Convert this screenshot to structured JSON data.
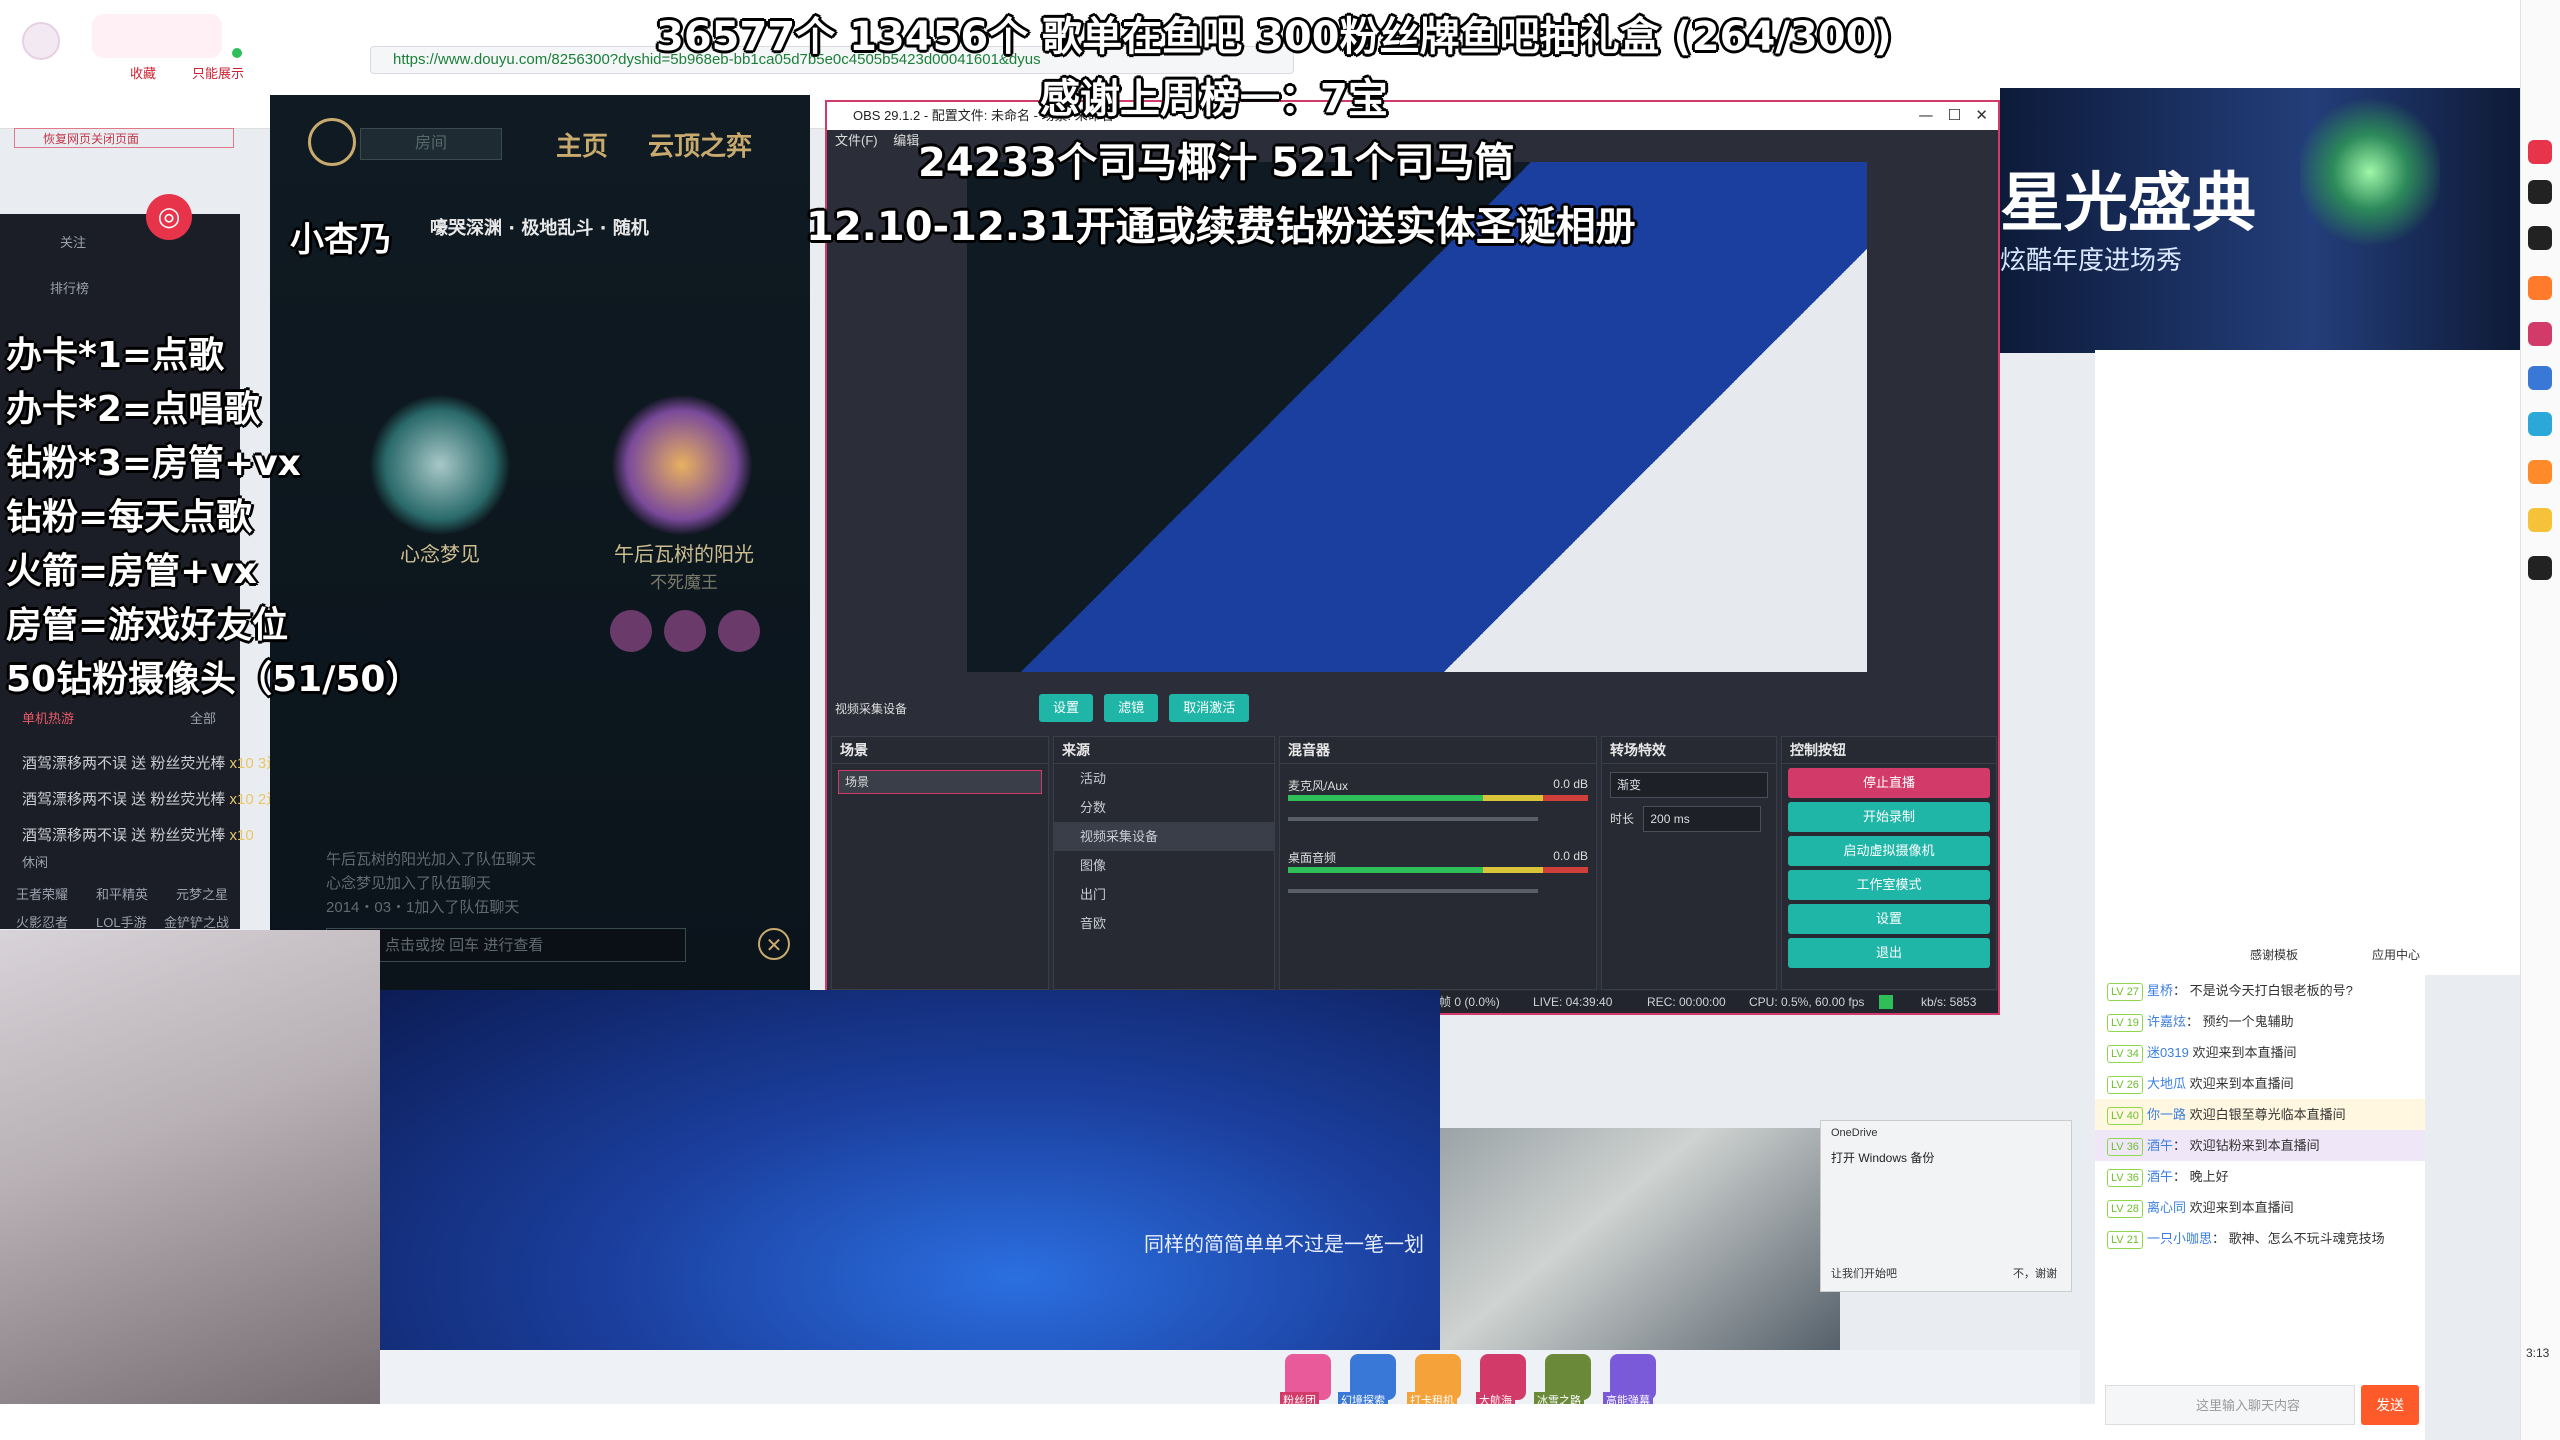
{
  "browser": {
    "url": "https://www.douyu.com/8256300?dyshid=5b968eb-bb1ca05d7b5e0c4505b5423d00041601&dyus",
    "tab_left": "收藏",
    "tab_next": "只能展示",
    "notice": "恢复网页关闭页面"
  },
  "overlay": {
    "line1": "36577个 13456个  歌单在鱼吧 300粉丝牌鱼吧抽礼盒 (264/300)",
    "line2": "感谢上周榜一：7宝",
    "line3": "24233个司马椰汁  521个司马筒",
    "line4": "12.10-12.31开通或续费钻粉送实体圣诞相册"
  },
  "rules": [
    "办卡*1=点歌",
    "办卡*2=点唱歌",
    "钻粉*3=房管+vx",
    "钻粉=每天点歌",
    "火箭=房管+vx",
    "房管=游戏好友位",
    "50钻粉摄像头（51/50）"
  ],
  "left_panel": {
    "follow": "关注",
    "rank": "排行榜",
    "hot": "单机热游",
    "more": "全部",
    "leisure": "休闲",
    "games": [
      "王者荣耀",
      "和平精英",
      "元梦之星",
      "火影忍者",
      "LOL手游",
      "金铲铲之战"
    ],
    "gift_msgs": [
      {
        "text": "酒驾漂移两不误 送 粉丝荧光棒",
        "count": "x10 3连击"
      },
      {
        "text": "酒驾漂移两不误 送 粉丝荧光棒",
        "count": "x10 2连击"
      },
      {
        "text": "酒驾漂移两不误 送 粉丝荧光棒",
        "count": "x10"
      }
    ]
  },
  "lol": {
    "search": "房间",
    "nav_home": "主页",
    "nav_tft": "云顶之弈",
    "user": "小杏乃",
    "mode": "嚎哭深渊 · 极地乱斗 · 随机",
    "player1": "心念梦见",
    "player2": "午后瓦树的阳光",
    "player2_rank": "不死魔王",
    "chat": [
      "午后瓦树的阳光加入了队伍聊天",
      "心念梦见加入了队伍聊天",
      "2014・03・1加入了队伍聊天"
    ],
    "chat_hint": "点击或按 回车 进行查看"
  },
  "obs": {
    "title": "OBS 29.1.2 - 配置文件: 未命名 - 场景: 未命名",
    "menu": [
      "文件(F)",
      "编辑"
    ],
    "source_label": "视频采集设备",
    "tb_settings": "设置",
    "tb_filters": "滤镜",
    "tb_deactivate": "取消激活",
    "scenes_title": "场景",
    "scene_item": "场景",
    "sources_title": "来源",
    "sources": [
      "活动",
      "分数",
      "视频采集设备",
      "图像",
      "出门",
      "音欧"
    ],
    "mixer_title": "混音器",
    "mic_label": "麦克风/Aux",
    "mic_db": "0.0 dB",
    "desk_label": "桌面音频",
    "desk_db": "0.0 dB",
    "trans_title": "转场特效",
    "trans_value": "渐变",
    "duration_label": "时长",
    "duration_value": "200 ms",
    "controls_title": "控制按钮",
    "controls": [
      "停止直播",
      "开始录制",
      "启动虚拟摄像机",
      "工作室模式",
      "设置",
      "退出"
    ],
    "status": {
      "dropped": "丢帧 0 (0.0%)",
      "live": "LIVE: 04:39:40",
      "rec": "REC: 00:00:00",
      "cpu": "CPU: 0.5%, 60.00 fps",
      "kbs": "kb/s: 5853"
    }
  },
  "banner": {
    "title": "星光盛典",
    "subtitle": "炫酷年度进场秀"
  },
  "chat": {
    "messages": [
      {
        "lv": "LV 27",
        "nick": "星桥",
        "text": "不是说今天打白银老板的号?"
      },
      {
        "lv": "LV 19",
        "nick": "许嘉炫",
        "text": "预约一个鬼辅助"
      },
      {
        "lv": "LV 34",
        "nick": "迷0319",
        "text": "欢迎来到本直播间"
      },
      {
        "lv": "LV 26",
        "nick": "大地瓜",
        "text": "欢迎来到本直播间"
      },
      {
        "lv": "LV 40",
        "nick": "你一路",
        "text": "欢迎白银至尊光临本直播间"
      },
      {
        "lv": "LV 36",
        "nick": "酒午",
        "text": "欢迎钻粉来到本直播间"
      },
      {
        "lv": "LV 36",
        "nick": "酒午",
        "text": "晚上好"
      },
      {
        "lv": "LV 28",
        "nick": "离心同",
        "text": "欢迎来到本直播间"
      },
      {
        "lv": "LV 21",
        "nick": "一只小咖思",
        "text": "歌神、怎么不玩斗魂竞技场"
      }
    ],
    "input_placeholder": "这里输入聊天内容",
    "send": "发送",
    "tool": "感谢模板",
    "app": "应用中心"
  },
  "desktop": {
    "subtitle": "同样的简简单单不过是一笔一划",
    "onedrive_title": "OneDrive",
    "onedrive_head": "打开 Windows 备份",
    "onedrive_btn1": "让我们开始吧",
    "onedrive_btn2": "不，谢谢",
    "time": "3:13"
  },
  "gifts": [
    "粉丝团",
    "幻境探索",
    "打卡租机",
    "大航海",
    "冰雪之路",
    "高能弹幕"
  ],
  "colors": {
    "obs_accent": "#1fb6a8",
    "obs_live": "#d23a6a",
    "overlay_text": "#ffffff"
  }
}
